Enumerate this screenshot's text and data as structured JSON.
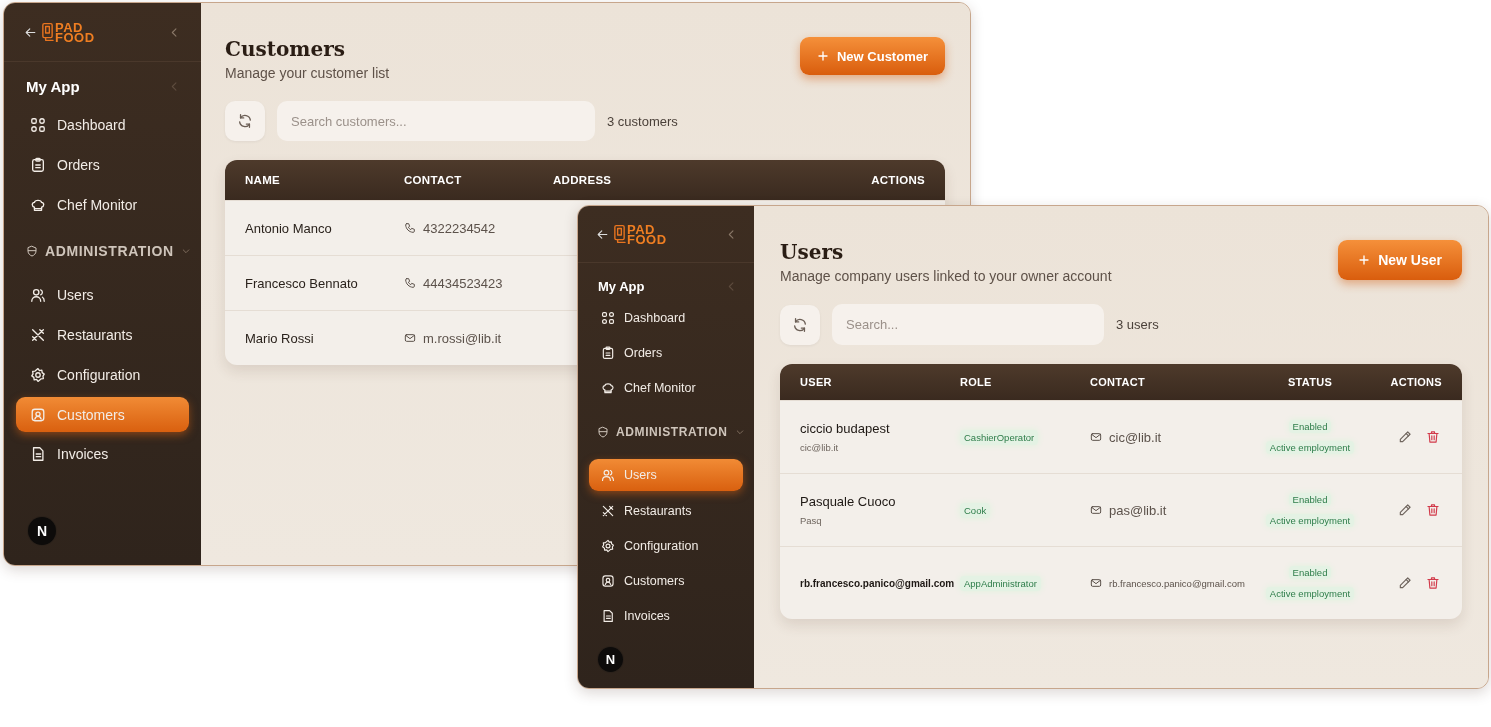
{
  "windows": [
    {
      "logo": {
        "line_1": "PAD",
        "line_2": "FOOD"
      },
      "app_title": "My App",
      "nav_main": [
        {
          "label": "Dashboard",
          "selected": false
        },
        {
          "label": "Orders",
          "selected": false
        },
        {
          "label": "Chef Monitor",
          "selected": false
        }
      ],
      "section": {
        "label": "ADMINISTRATION",
        "expanded": true
      },
      "nav_admin": [
        {
          "label": "Users",
          "selected": false
        },
        {
          "label": "Restaurants",
          "selected": false
        },
        {
          "label": "Configuration",
          "selected": false
        },
        {
          "label": "Customers",
          "selected": true
        },
        {
          "label": "Invoices",
          "selected": false
        }
      ],
      "avatar": "N",
      "page": {
        "title": "Customers",
        "subtitle": "Manage your customer list",
        "new_button": "New Customer",
        "search_placeholder": "Search customers...",
        "count": "3 customers"
      },
      "table": {
        "kind": "customers",
        "columns": [
          "NAME",
          "CONTACT",
          "ADDRESS",
          "ACTIONS"
        ],
        "rows": [
          {
            "cells": [
              {
                "kind": "text",
                "value": "Antonio Manco"
              },
              {
                "kind": "phone",
                "value": "4322234542"
              }
            ]
          },
          {
            "cells": [
              {
                "kind": "text",
                "value": "Francesco Bennato"
              },
              {
                "kind": "phone",
                "value": "44434523423"
              }
            ]
          },
          {
            "cells": [
              {
                "kind": "text",
                "value": "Mario Rossi"
              },
              {
                "kind": "email",
                "value": "m.rossi@lib.it"
              }
            ]
          }
        ]
      }
    },
    {
      "logo": {
        "line_1": "PAD",
        "line_2": "FOOD"
      },
      "app_title": "My App",
      "nav_main": [
        {
          "label": "Dashboard",
          "selected": false
        },
        {
          "label": "Orders",
          "selected": false
        },
        {
          "label": "Chef Monitor",
          "selected": false
        }
      ],
      "section": {
        "label": "ADMINISTRATION",
        "expanded": true
      },
      "nav_admin": [
        {
          "label": "Users",
          "selected": true
        },
        {
          "label": "Restaurants",
          "selected": false
        },
        {
          "label": "Configuration",
          "selected": false
        },
        {
          "label": "Customers",
          "selected": false
        },
        {
          "label": "Invoices",
          "selected": false
        }
      ],
      "avatar": "N",
      "page": {
        "title": "Users",
        "subtitle": "Manage company users linked to your owner account",
        "new_button": "New User",
        "search_placeholder": "Search...",
        "count": "3 users"
      },
      "table": {
        "kind": "users",
        "columns": [
          "USER",
          "ROLE",
          "CONTACT",
          "STATUS",
          "ACTIONS"
        ],
        "rows": [
          {
            "cells": [
              {
                "kind": "user",
                "name": "ciccio budapest",
                "username": "cic@lib.it"
              },
              {
                "kind": "badge",
                "value": "CashierOperator"
              },
              {
                "kind": "email",
                "value": "cic@lib.it"
              },
              {
                "kind": "status",
                "values": [
                  "Enabled",
                  "Active employment"
                ]
              },
              {
                "kind": "actions"
              }
            ]
          },
          {
            "cells": [
              {
                "kind": "user",
                "name": "Pasquale Cuoco",
                "username": "Pasq"
              },
              {
                "kind": "badge",
                "value": "Cook"
              },
              {
                "kind": "email",
                "value": "pas@lib.it"
              },
              {
                "kind": "status",
                "values": [
                  "Enabled",
                  "Active employment"
                ]
              },
              {
                "kind": "actions"
              }
            ]
          },
          {
            "cells": [
              {
                "kind": "user",
                "name": "rb.francesco.panico@gmail.com"
              },
              {
                "kind": "badge",
                "value": "AppAdministrator"
              },
              {
                "kind": "email",
                "value": "rb.francesco.panico@gmail.com"
              },
              {
                "kind": "status",
                "values": [
                  "Enabled",
                  "Active employment"
                ]
              },
              {
                "kind": "actions"
              }
            ]
          }
        ]
      }
    }
  ]
}
